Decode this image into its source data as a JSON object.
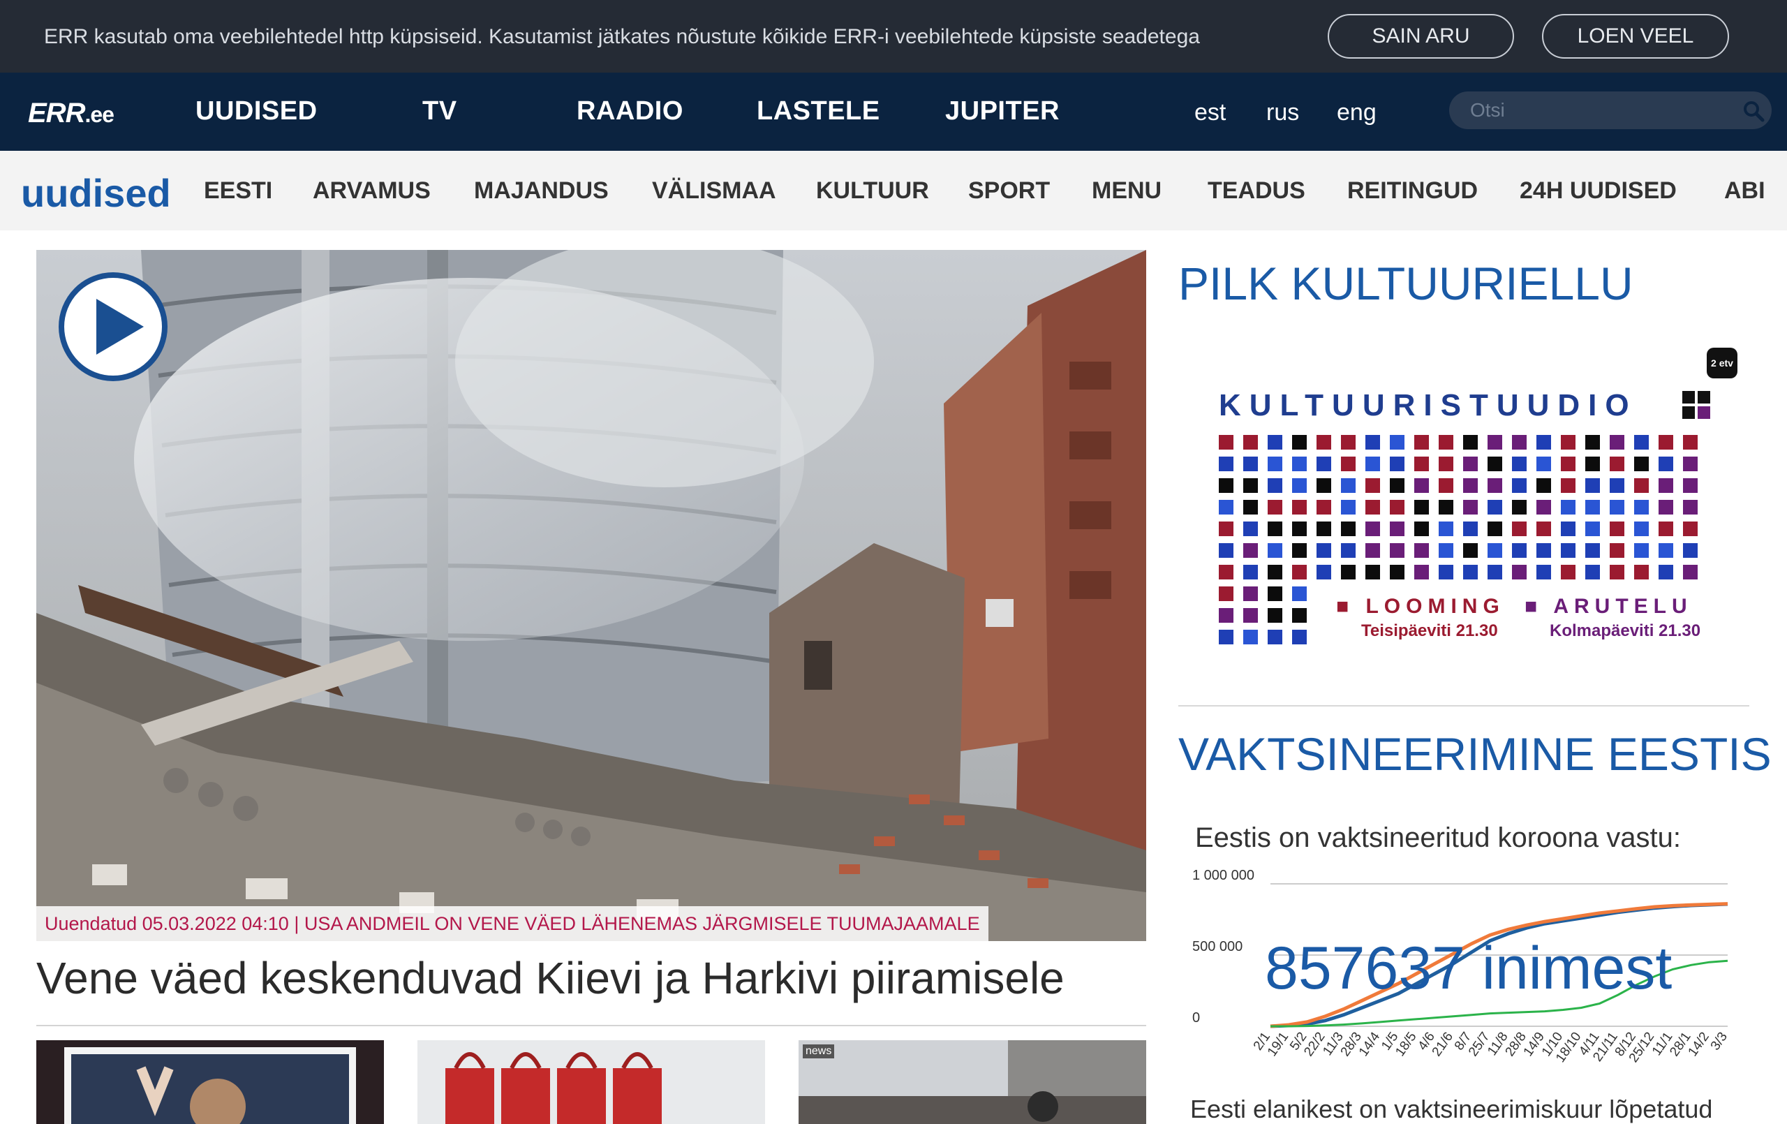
{
  "cookie_bar": {
    "text": "ERR kasutab oma veebilehtedel http küpsiseid. Kasutamist jätkates nõustute kõikide ERR-i veebilehtede küpsiste seadetega",
    "accept_label": "SAIN ARU",
    "more_label": "LOEN VEEL"
  },
  "main_nav": {
    "logo_main": "ERR",
    "logo_suffix": ".ee",
    "items": [
      "UUDISED",
      "TV",
      "RAADIO",
      "LASTELE",
      "JUPITER"
    ],
    "languages": [
      "est",
      "rus",
      "eng"
    ],
    "search_placeholder": "Otsi"
  },
  "section_nav": {
    "title": "uudised",
    "items": [
      "EESTI",
      "ARVAMUS",
      "MAJANDUS",
      "VÄLISMAA",
      "KULTUUR",
      "SPORT",
      "MENU",
      "TEADUS",
      "REITINGUD",
      "24H UUDISED",
      "ABI"
    ]
  },
  "hero": {
    "caption": "Uuendatud 05.03.2022 04:10 | USA ANDMEIL ON VENE VÄED LÄHENEMAS JÄRGMISELE TUUMAJAAMALE",
    "headline": "Vene väed keskenduvad Kiievi ja Harkivi piiramisele",
    "thumb3_label": "news"
  },
  "sidebar": {
    "heading1": "PILK KULTUURIELLU",
    "kultuur": {
      "channel": "2 etv",
      "title": "KULTUURISTUUDIO",
      "show1": "LOOMING",
      "show1_time": "Teisipäeviti 21.30",
      "show2": "ARUTELU",
      "show2_time": "Kolmapäeviti 21.30"
    },
    "heading2": "VAKTSINEERIMINE EESTIS",
    "vacc_subtitle": "Eestis on vaktsineeritud koroona vastu:",
    "vacc_count": "857637 inimest",
    "vacc_footer": "Eesti elanikest on vaktsineerimiskuur lõpetatud"
  },
  "chart_data": {
    "type": "line",
    "yticks": [
      "1 000 000",
      "500 000",
      "0"
    ],
    "ylim": [
      0,
      1000000
    ],
    "categories": [
      "2/1",
      "19/1",
      "5/2",
      "22/2",
      "11/3",
      "28/3",
      "14/4",
      "1/5",
      "18/5",
      "4/6",
      "21/6",
      "8/7",
      "25/7",
      "11/8",
      "28/8",
      "14/9",
      "1/10",
      "18/10",
      "4/11",
      "21/11",
      "8/12",
      "25/12",
      "11/1",
      "28/1",
      "14/2",
      "3/3"
    ],
    "series": [
      {
        "color": "#1f5f9e",
        "values": [
          0,
          5000,
          15000,
          40000,
          80000,
          130000,
          180000,
          230000,
          300000,
          370000,
          440000,
          520000,
          600000,
          650000,
          690000,
          720000,
          740000,
          760000,
          780000,
          800000,
          815000,
          830000,
          840000,
          848000,
          853000,
          857637
        ]
      },
      {
        "color": "#f07a3a",
        "values": [
          0,
          10000,
          30000,
          70000,
          120000,
          180000,
          240000,
          300000,
          370000,
          440000,
          510000,
          580000,
          640000,
          680000,
          710000,
          735000,
          755000,
          775000,
          795000,
          810000,
          825000,
          838000,
          846000,
          852000,
          856000,
          860000
        ]
      },
      {
        "color": "#2bb34a",
        "values": [
          0,
          0,
          2000,
          6000,
          12000,
          20000,
          30000,
          40000,
          50000,
          60000,
          70000,
          80000,
          90000,
          95000,
          100000,
          105000,
          115000,
          130000,
          160000,
          220000,
          290000,
          350000,
          400000,
          430000,
          450000,
          460000
        ]
      }
    ]
  }
}
